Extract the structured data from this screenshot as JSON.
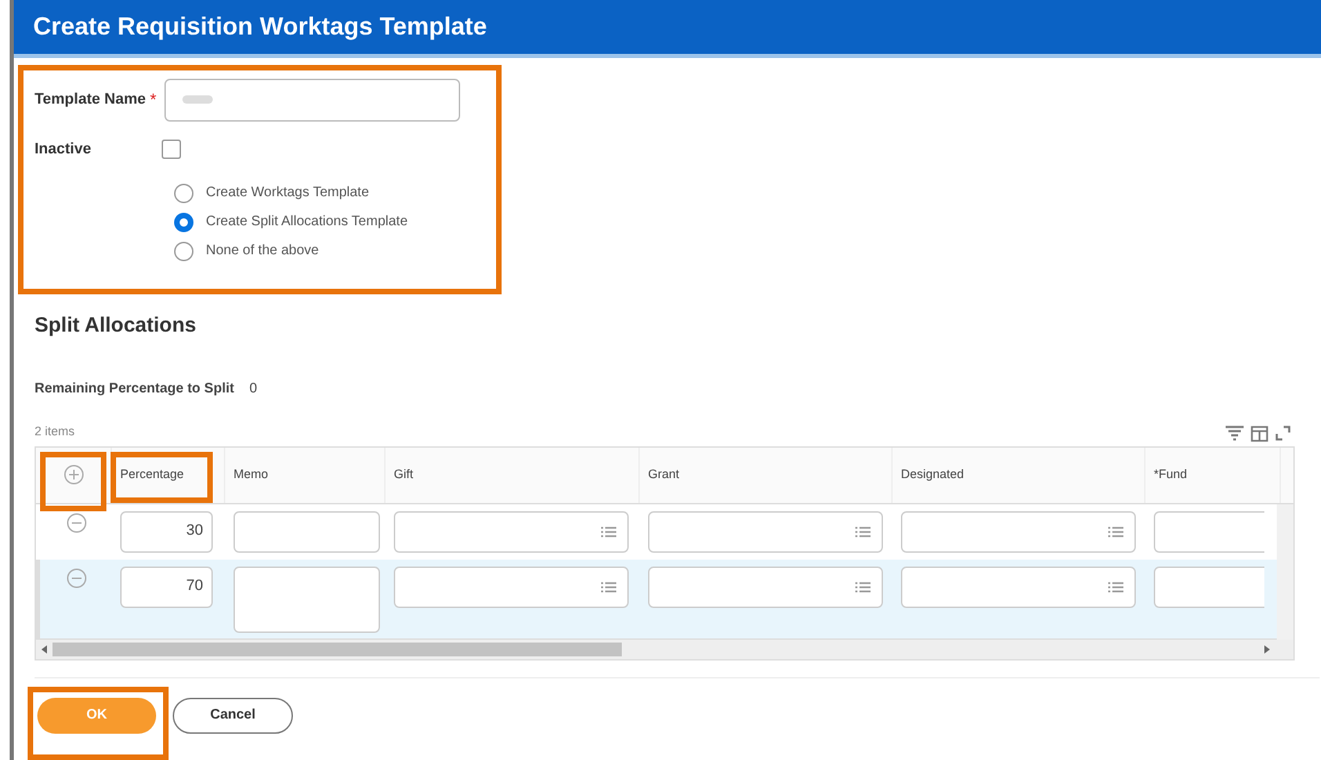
{
  "title": "Create Requisition Worktags Template",
  "form": {
    "template_name": {
      "label": "Template Name",
      "required_mark": "*"
    },
    "inactive": {
      "label": "Inactive",
      "checked": false
    },
    "options": [
      {
        "label": "Create Worktags Template",
        "selected": false
      },
      {
        "label": "Create Split Allocations Template",
        "selected": true
      },
      {
        "label": "None of the above",
        "selected": false
      }
    ]
  },
  "split_allocations": {
    "heading": "Split Allocations",
    "remaining_label": "Remaining Percentage to Split",
    "remaining_value": "0",
    "item_count": "2 items",
    "columns": [
      "Percentage",
      "Memo",
      "Gift",
      "Grant",
      "Designated",
      "*Fund"
    ],
    "rows": [
      {
        "selected": false,
        "percentage": "30"
      },
      {
        "selected": true,
        "percentage": "70"
      }
    ]
  },
  "buttons": [
    {
      "label": "OK",
      "kind": "primary"
    },
    {
      "label": "Cancel",
      "kind": "secondary"
    }
  ]
}
